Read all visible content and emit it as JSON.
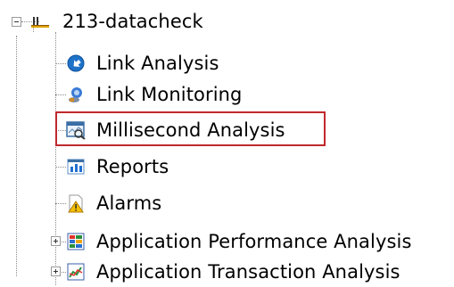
{
  "tree": {
    "root": {
      "label": "213-datacheck",
      "icon": "server-node-icon"
    },
    "children": [
      {
        "label": "Link Analysis",
        "icon": "link-analysis-icon"
      },
      {
        "label": "Link Monitoring",
        "icon": "link-monitoring-icon"
      },
      {
        "label": "Millisecond Analysis",
        "icon": "millisecond-analysis-icon"
      },
      {
        "label": "Reports",
        "icon": "reports-icon"
      },
      {
        "label": "Alarms",
        "icon": "alarm-warning-icon"
      },
      {
        "label": "Application Performance Analysis",
        "icon": "app-performance-icon"
      },
      {
        "label": "Application Transaction Analysis",
        "icon": "app-transaction-icon"
      }
    ]
  },
  "colors": {
    "highlight_border": "#c0282d",
    "tree_line": "#8c8c8c"
  }
}
